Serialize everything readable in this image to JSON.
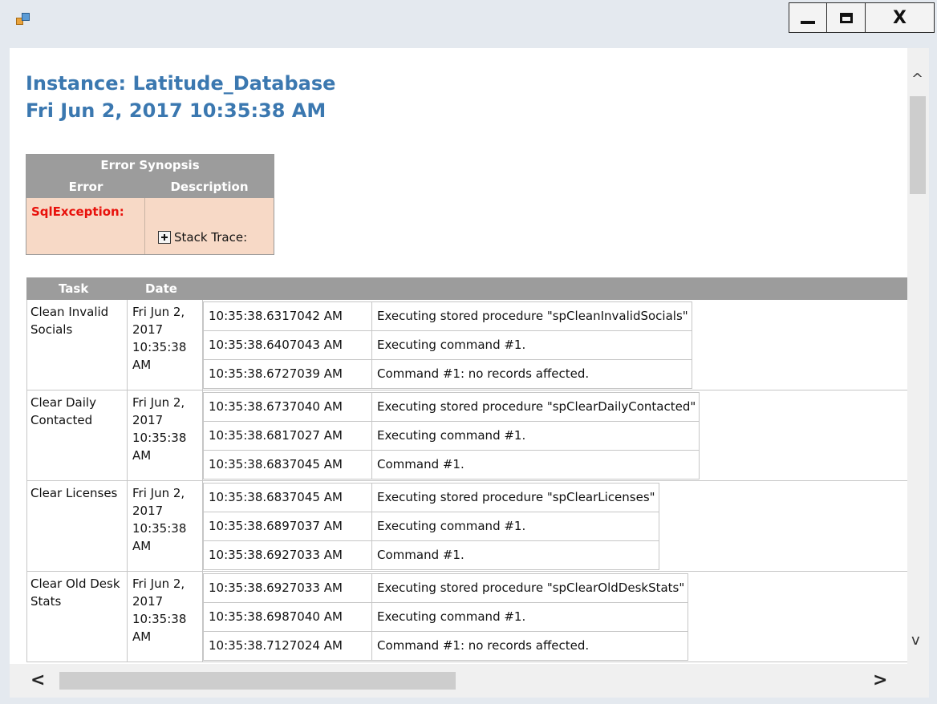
{
  "window": {
    "icon": "app-icon",
    "controls": {
      "minimize": "minimize-icon",
      "maximize": "maximize-icon",
      "close_label": "X"
    }
  },
  "header": {
    "instance": "Instance: Latitude_Database",
    "timestamp": "Fri Jun 2, 2017 10:35:38 AM"
  },
  "synopsis": {
    "title": "Error Synopsis",
    "col_error": "Error",
    "col_description": "Description",
    "error": "SqlException:",
    "stack_trace_label": "Stack Trace:"
  },
  "tasks": {
    "col_task": "Task",
    "col_date": "Date",
    "rows": [
      {
        "name": "Clean Invalid Socials",
        "date": "Fri Jun 2, 2017 10:35:38 AM",
        "logs": [
          {
            "time": "10:35:38.6317042 AM",
            "message": "Executing stored procedure \"spCleanInvalidSocials\""
          },
          {
            "time": "10:35:38.6407043 AM",
            "message": "Executing command #1."
          },
          {
            "time": "10:35:38.6727039 AM",
            "message": "Command #1: no records affected."
          }
        ]
      },
      {
        "name": "Clear Daily Contacted",
        "date": "Fri Jun 2, 2017 10:35:38 AM",
        "logs": [
          {
            "time": "10:35:38.6737040 AM",
            "message": "Executing stored procedure \"spClearDailyContacted\""
          },
          {
            "time": "10:35:38.6817027 AM",
            "message": "Executing command #1."
          },
          {
            "time": "10:35:38.6837045 AM",
            "message": "Command #1."
          }
        ]
      },
      {
        "name": "Clear Licenses",
        "date": "Fri Jun 2, 2017 10:35:38 AM",
        "logs": [
          {
            "time": "10:35:38.6837045 AM",
            "message": "Executing stored procedure \"spClearLicenses\""
          },
          {
            "time": "10:35:38.6897037 AM",
            "message": "Executing command #1."
          },
          {
            "time": "10:35:38.6927033 AM",
            "message": "Command #1."
          }
        ]
      },
      {
        "name": "Clear Old Desk Stats",
        "date": "Fri Jun 2, 2017 10:35:38 AM",
        "logs": [
          {
            "time": "10:35:38.6927033 AM",
            "message": "Executing stored procedure \"spClearOldDeskStats\""
          },
          {
            "time": "10:35:38.6987040 AM",
            "message": "Executing command #1."
          },
          {
            "time": "10:35:38.7127024 AM",
            "message": "Command #1: no records affected."
          }
        ]
      }
    ]
  },
  "scrollbars": {
    "up": "^",
    "down": "v",
    "left": "<",
    "right": ">"
  }
}
